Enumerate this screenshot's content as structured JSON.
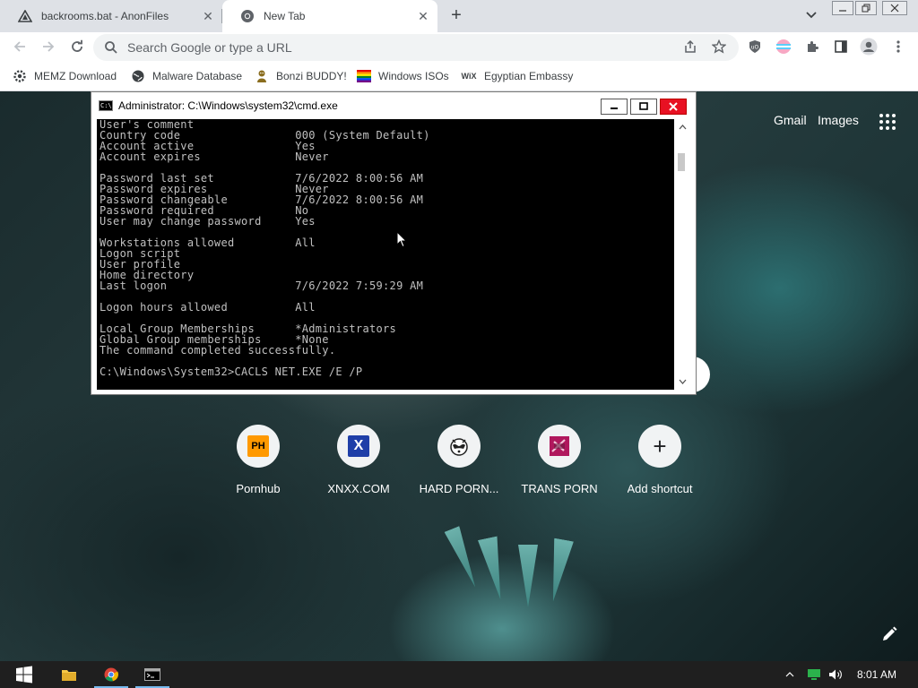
{
  "browser": {
    "tabs": [
      {
        "title": "backrooms.bat - AnonFiles",
        "active": false,
        "icon": "anonfiles-icon"
      },
      {
        "title": "New Tab",
        "active": true,
        "icon": "chrome-icon"
      }
    ],
    "omnibox_placeholder": "Search Google or type a URL"
  },
  "bookmarks": [
    {
      "label": "MEMZ Download",
      "icon": "memz-gear-icon"
    },
    {
      "label": "Malware Database",
      "icon": "globe-icon"
    },
    {
      "label": "Bonzi BUDDY!",
      "icon": "bonzi-icon"
    },
    {
      "label": "Windows ISOs",
      "icon": "rainbow-flag-icon"
    },
    {
      "label": "Egyptian Embassy",
      "icon": "wix-icon"
    }
  ],
  "ntp": {
    "links": {
      "gmail": "Gmail",
      "images": "Images"
    },
    "shortcuts": [
      {
        "label": "Pornhub",
        "logo_text": "PH"
      },
      {
        "label": "XNXX.COM",
        "logo_text": "X"
      },
      {
        "label": "HARD PORN...",
        "logo_text": ""
      },
      {
        "label": "TRANS PORN",
        "logo_text": ""
      },
      {
        "label": "Add shortcut",
        "logo_text": "+"
      }
    ]
  },
  "cmd": {
    "title": "Administrator: C:\\Windows\\system32\\cmd.exe",
    "icon_text": "C:\\",
    "lines": [
      "User's comment",
      "Country code                 000 (System Default)",
      "Account active               Yes",
      "Account expires              Never",
      "",
      "Password last set            7/6/2022 8:00:56 AM",
      "Password expires             Never",
      "Password changeable          7/6/2022 8:00:56 AM",
      "Password required            No",
      "User may change password     Yes",
      "",
      "Workstations allowed         All",
      "Logon script",
      "User profile",
      "Home directory",
      "Last logon                   7/6/2022 7:59:29 AM",
      "",
      "Logon hours allowed          All",
      "",
      "Local Group Memberships      *Administrators",
      "Global Group memberships     *None",
      "The command completed successfully.",
      "",
      "C:\\Windows\\System32>CACLS NET.EXE /E /P"
    ]
  },
  "taskbar": {
    "clock": "8:01 AM"
  },
  "colors": {
    "tabstrip": "#dee1e6",
    "console_text": "#c0c0c0",
    "close_red": "#e81123"
  }
}
